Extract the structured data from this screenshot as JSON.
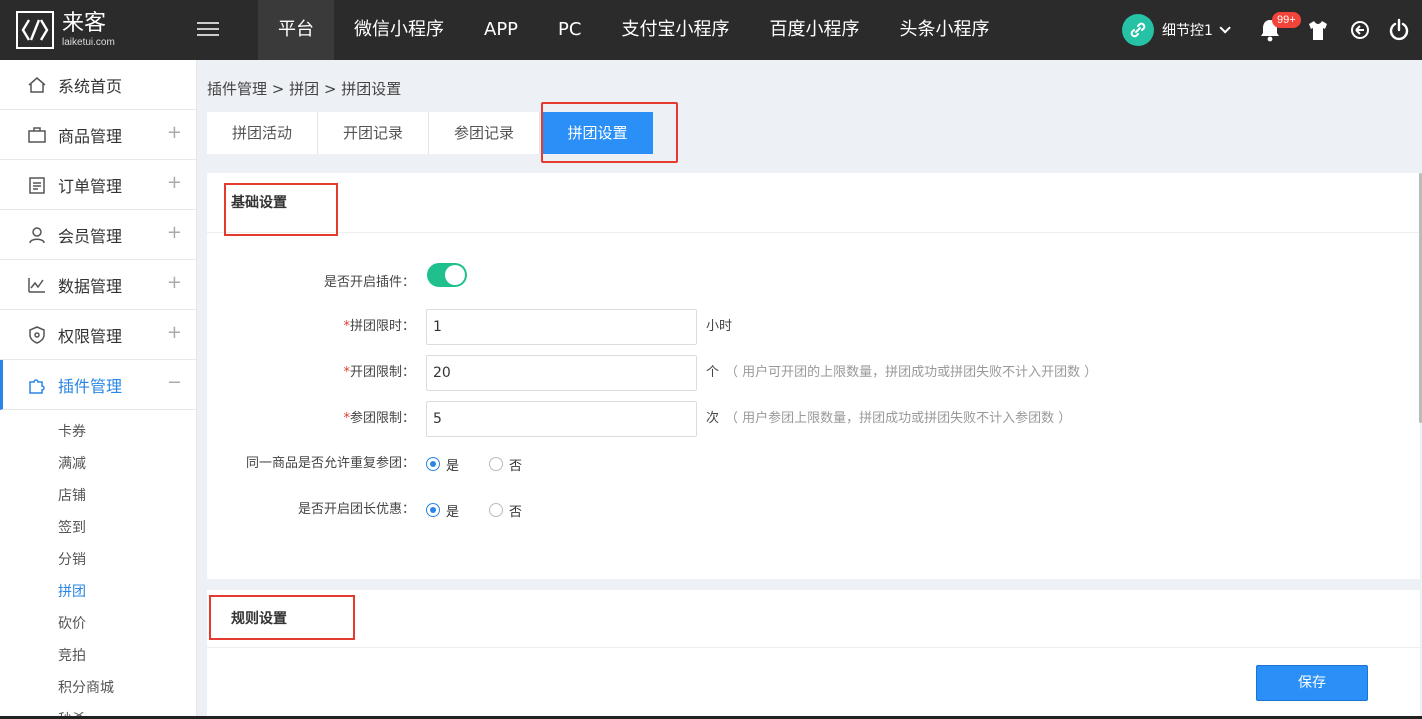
{
  "app": {
    "logo_cn": "来客",
    "logo_en": "laiketui.com"
  },
  "topnav": {
    "items": [
      "平台",
      "微信小程序",
      "APP",
      "PC",
      "支付宝小程序",
      "百度小程序",
      "头条小程序"
    ],
    "active_index": 0
  },
  "user": {
    "name": "细节控1",
    "notification_count": "99+"
  },
  "sidebar": {
    "items": [
      {
        "label": "系统首页",
        "icon": "home-icon"
      },
      {
        "label": "商品管理",
        "icon": "box-icon"
      },
      {
        "label": "订单管理",
        "icon": "clipboard-icon"
      },
      {
        "label": "会员管理",
        "icon": "user-icon"
      },
      {
        "label": "数据管理",
        "icon": "chart-icon"
      },
      {
        "label": "权限管理",
        "icon": "shield-icon"
      },
      {
        "label": "插件管理",
        "icon": "puzzle-icon"
      }
    ],
    "expand_symbol": "+",
    "collapse_symbol": "−",
    "sub_items": [
      "卡券",
      "满减",
      "店铺",
      "签到",
      "分销",
      "拼团",
      "砍价",
      "竞拍",
      "积分商城",
      "秒杀"
    ],
    "active_sub": "拼团"
  },
  "breadcrumb": "插件管理 > 拼团 > 拼团设置",
  "tabs": [
    "拼团活动",
    "开团记录",
    "参团记录",
    "拼团设置"
  ],
  "basic": {
    "title": "基础设置",
    "enable_label": "是否开启插件：",
    "enable_on": true,
    "time_limit": {
      "label": "拼团限时：",
      "value": "1",
      "unit": "小时"
    },
    "open_limit": {
      "label": "开团限制：",
      "value": "20",
      "unit": "个",
      "hint": "（ 用户可开团的上限数量，拼团成功或拼团失败不计入开团数 ）"
    },
    "join_limit": {
      "label": "参团限制：",
      "value": "5",
      "unit": "次",
      "hint": "（ 用户参团上限数量，拼团成功或拼团失败不计入参团数 ）"
    },
    "repeat_join": {
      "label": "同一商品是否允许重复参团：",
      "yes": "是",
      "no": "否",
      "selected": "是"
    },
    "leader_discount": {
      "label": "是否开启团长优惠：",
      "yes": "是",
      "no": "否",
      "selected": "是"
    }
  },
  "rules": {
    "title": "规则设置"
  },
  "actions": {
    "save": "保存"
  },
  "colors": {
    "topbar": "#2b2b2b",
    "accent": "#2a8ff7",
    "highlight": "#e53a2f",
    "toggle_on": "#1fc08e"
  }
}
